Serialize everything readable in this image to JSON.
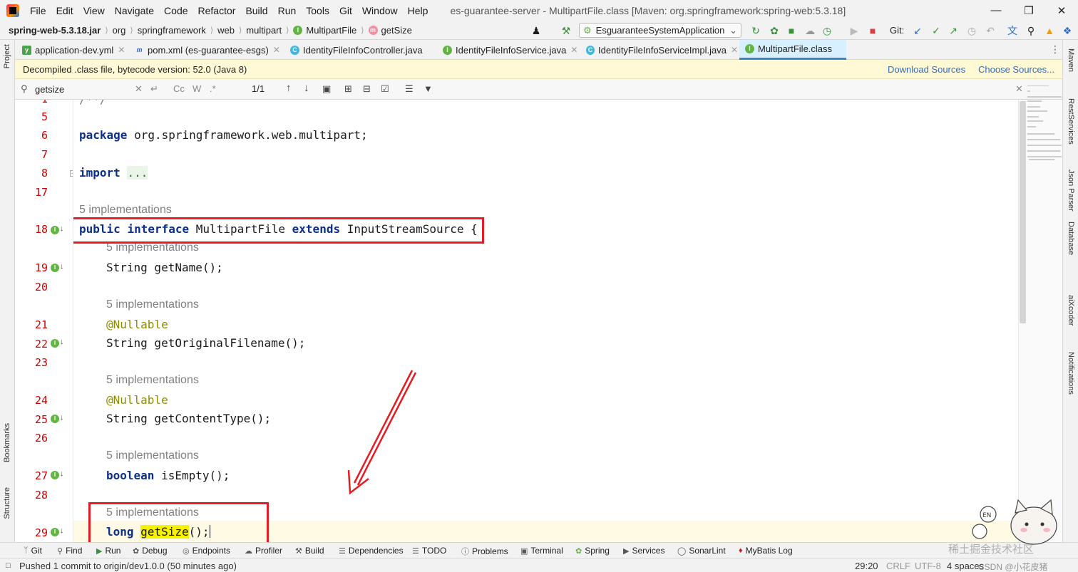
{
  "menubar": {
    "items": [
      "File",
      "Edit",
      "View",
      "Navigate",
      "Code",
      "Refactor",
      "Build",
      "Run",
      "Tools",
      "Git",
      "Window",
      "Help"
    ],
    "window_title": "es-guarantee-server - MultipartFile.class [Maven: org.springframework:spring-web:5.3.18]"
  },
  "navbar": {
    "crumbs": [
      "spring-web-5.3.18.jar",
      "org",
      "springframework",
      "web",
      "multipart",
      "MultipartFile",
      "getSize"
    ],
    "run_config": "EsguaranteeSystemApplication",
    "git_label": "Git:"
  },
  "tabs": [
    {
      "label": "application-dev.yml",
      "icon": "yaml-icon"
    },
    {
      "label": "pom.xml (es-guarantee-esgs)",
      "icon": "maven-icon"
    },
    {
      "label": "IdentityFileInfoController.java",
      "icon": "class-icon"
    },
    {
      "label": "IdentityFileInfoService.java",
      "icon": "interface-icon"
    },
    {
      "label": "IdentityFileInfoServiceImpl.java",
      "icon": "class-icon"
    },
    {
      "label": "MultipartFile.class",
      "icon": "interface-icon"
    }
  ],
  "banner": {
    "text": "Decompiled .class file, bytecode version: 52.0 (Java 8)",
    "download_sources": "Download Sources",
    "choose_sources": "Choose Sources..."
  },
  "find": {
    "query": "getsize",
    "match_count": "1/1",
    "cc": "Cc",
    "w": "W",
    "regex": ".*"
  },
  "editor": {
    "line_numbers": [
      "1",
      "5",
      "6",
      "7",
      "8",
      "17",
      "18",
      "19",
      "20",
      "21",
      "22",
      "23",
      "24",
      "25",
      "26",
      "27",
      "28",
      "29"
    ],
    "first_line": "/**/",
    "package_kw": "package",
    "package_name": "org.springframework.web.multipart;",
    "import_kw": "import",
    "import_fold": "...",
    "impl_hint": "5 implementations",
    "iface_public": "public",
    "iface_interface": "interface",
    "iface_name": "MultipartFile",
    "iface_extends": "extends",
    "iface_super": "InputStreamSource {",
    "m1": "String getName();",
    "nullable": "@Nullable",
    "m2": "String getOriginalFilename();",
    "m3": "String getContentType();",
    "m4_kw": "boolean",
    "m4": "isEmpty();",
    "m5_kw": "long",
    "m5_hl": "getSize",
    "m5_rest": "();"
  },
  "tool_windows": [
    "Git",
    "Find",
    "Run",
    "Debug",
    "Endpoints",
    "Profiler",
    "Build",
    "Dependencies",
    "TODO",
    "Problems",
    "Terminal",
    "Spring",
    "Services",
    "SonarLint",
    "MyBatis Log"
  ],
  "left_strip": [
    "Project",
    "Bookmarks",
    "Structure"
  ],
  "right_strip": [
    "Maven",
    "RestServices",
    "Json Parser",
    "Database",
    "aiXcoder",
    "Notifications"
  ],
  "status": {
    "message": "Pushed 1 commit to origin/dev1.0.0 (50 minutes ago)",
    "position": "29:20",
    "line_sep": "CRLF",
    "encoding": "UTF-8",
    "indent": "4 spaces"
  },
  "watermark": {
    "line1": "稀土掘金技术社区",
    "line2": "CSDN @小花皮猪"
  },
  "colors": {
    "keyword": "#0b2f8a",
    "line_number": "#d10000",
    "annotation_box": "#e51c23",
    "search_highlight": "#f6f200",
    "banner_bg": "#fff9d6",
    "link": "#2e6cc9"
  }
}
